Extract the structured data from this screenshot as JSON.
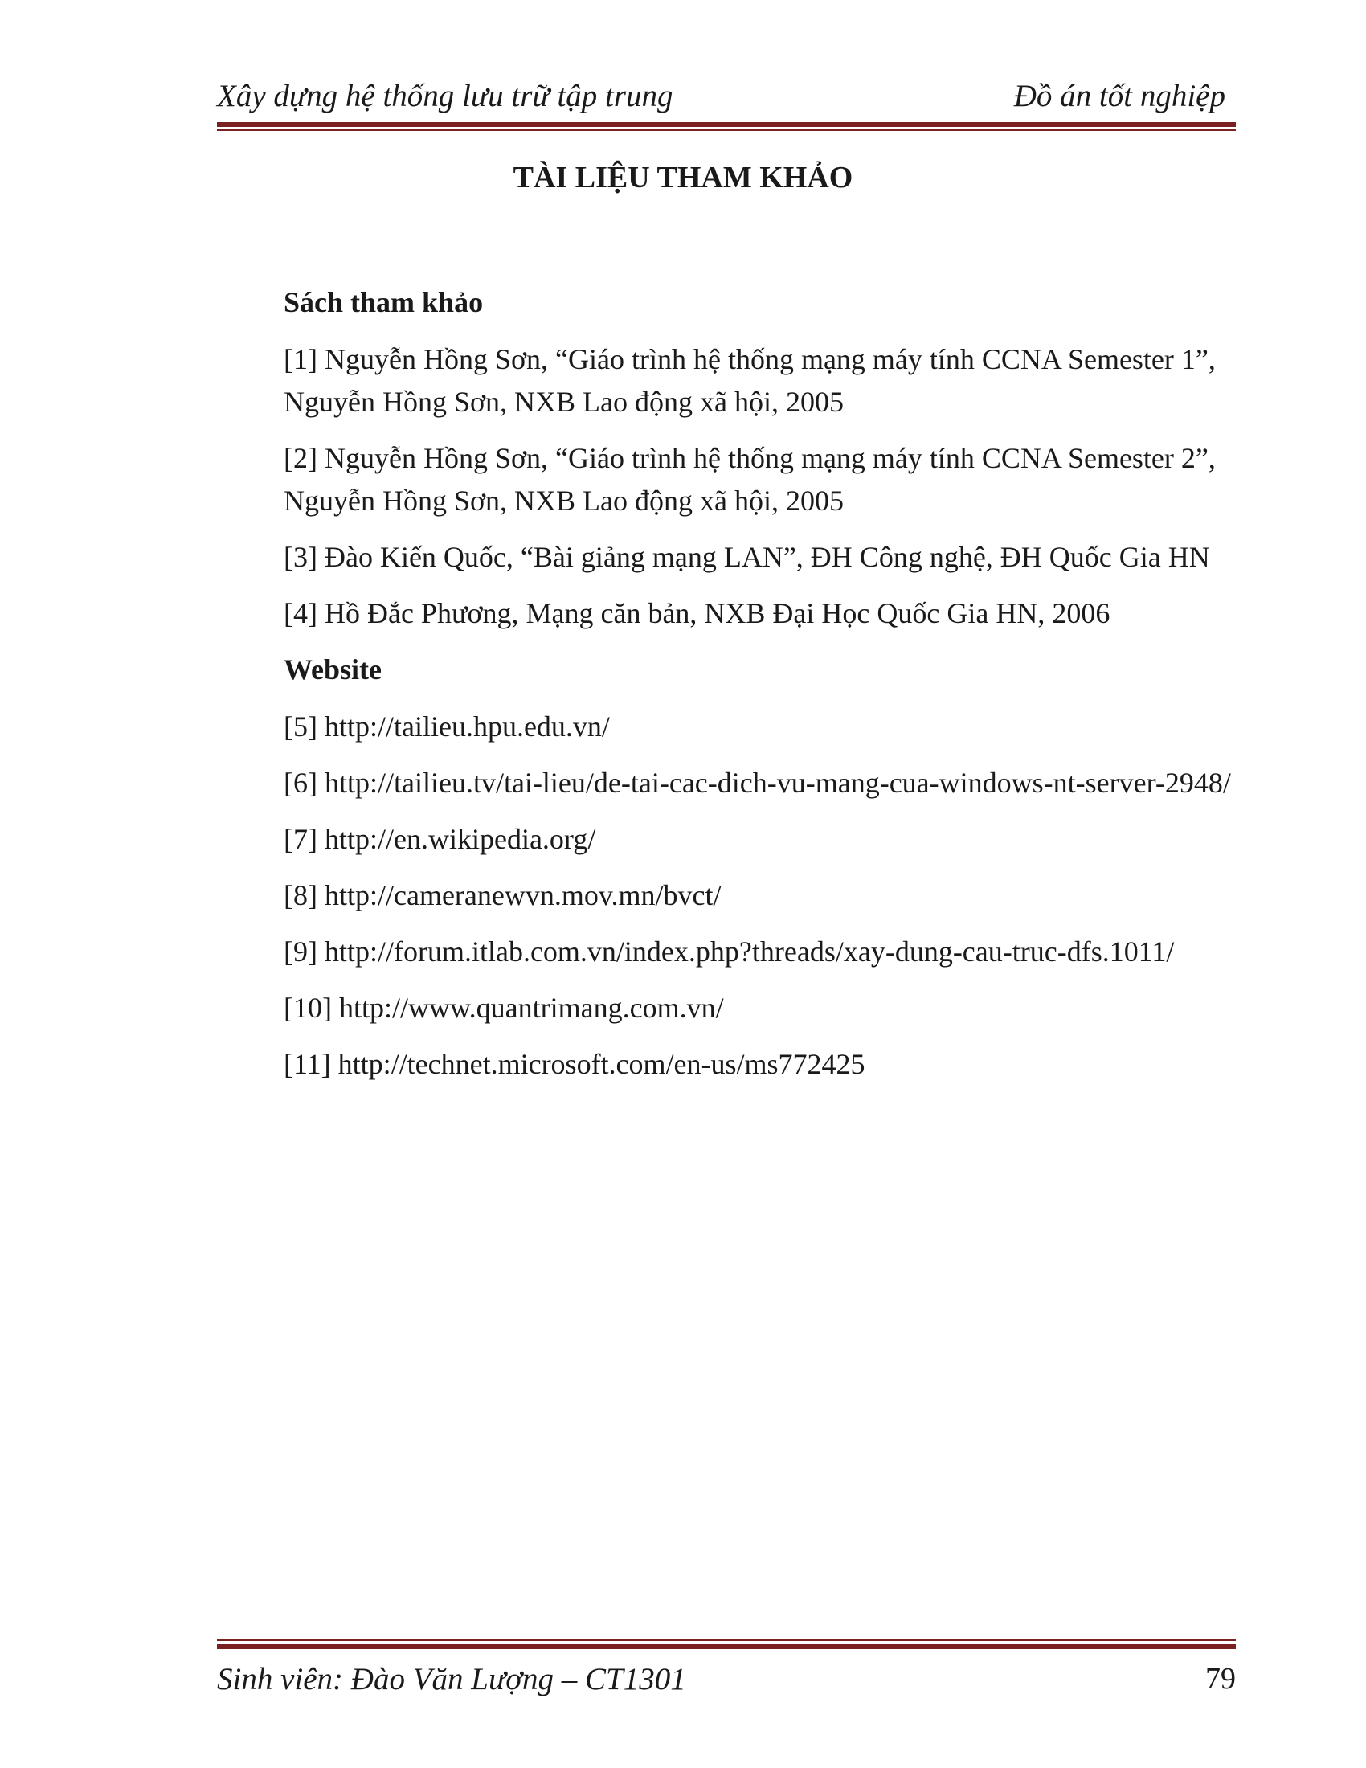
{
  "header": {
    "left": "Xây dựng hệ thống lưu trữ tập trung",
    "right": "Đồ án tốt nghiệp"
  },
  "title": "TÀI LIỆU THAM KHẢO",
  "books": {
    "heading": "Sách tham khảo",
    "items": [
      "[1] Nguyễn Hồng Sơn, “Giáo trình hệ thống mạng máy tính CCNA Semester 1”, Nguyễn Hồng Sơn, NXB Lao động xã hội, 2005",
      "[2] Nguyễn Hồng Sơn, “Giáo trình hệ thống mạng máy tính CCNA Semester 2”, Nguyễn Hồng Sơn, NXB Lao động xã hội, 2005",
      "[3] Đào Kiến Quốc, “Bài giảng mạng LAN”, ĐH Công nghệ, ĐH Quốc Gia HN",
      "[4] Hồ Đắc Phương, Mạng căn bản, NXB Đại Học Quốc Gia HN, 2006"
    ]
  },
  "websites": {
    "heading": "Website",
    "items": [
      "[5] http://tailieu.hpu.edu.vn/",
      "[6] http://tailieu.tv/tai-lieu/de-tai-cac-dich-vu-mang-cua-windows-nt-server-2948/",
      "[7] http://en.wikipedia.org/",
      "[8] http://cameranewvn.mov.mn/bvct/",
      "[9] http://forum.itlab.com.vn/index.php?threads/xay-dung-cau-truc-dfs.1011/",
      "[10] http://www.quantrimang.com.vn/",
      "[11] http://technet.microsoft.com/en-us/ms772425"
    ]
  },
  "footer": {
    "left": "Sinh viên: Đào Văn Lượng – CT1301",
    "page_number": "79"
  },
  "colors": {
    "rule": "#7b2121",
    "text": "#1a1a1a"
  }
}
